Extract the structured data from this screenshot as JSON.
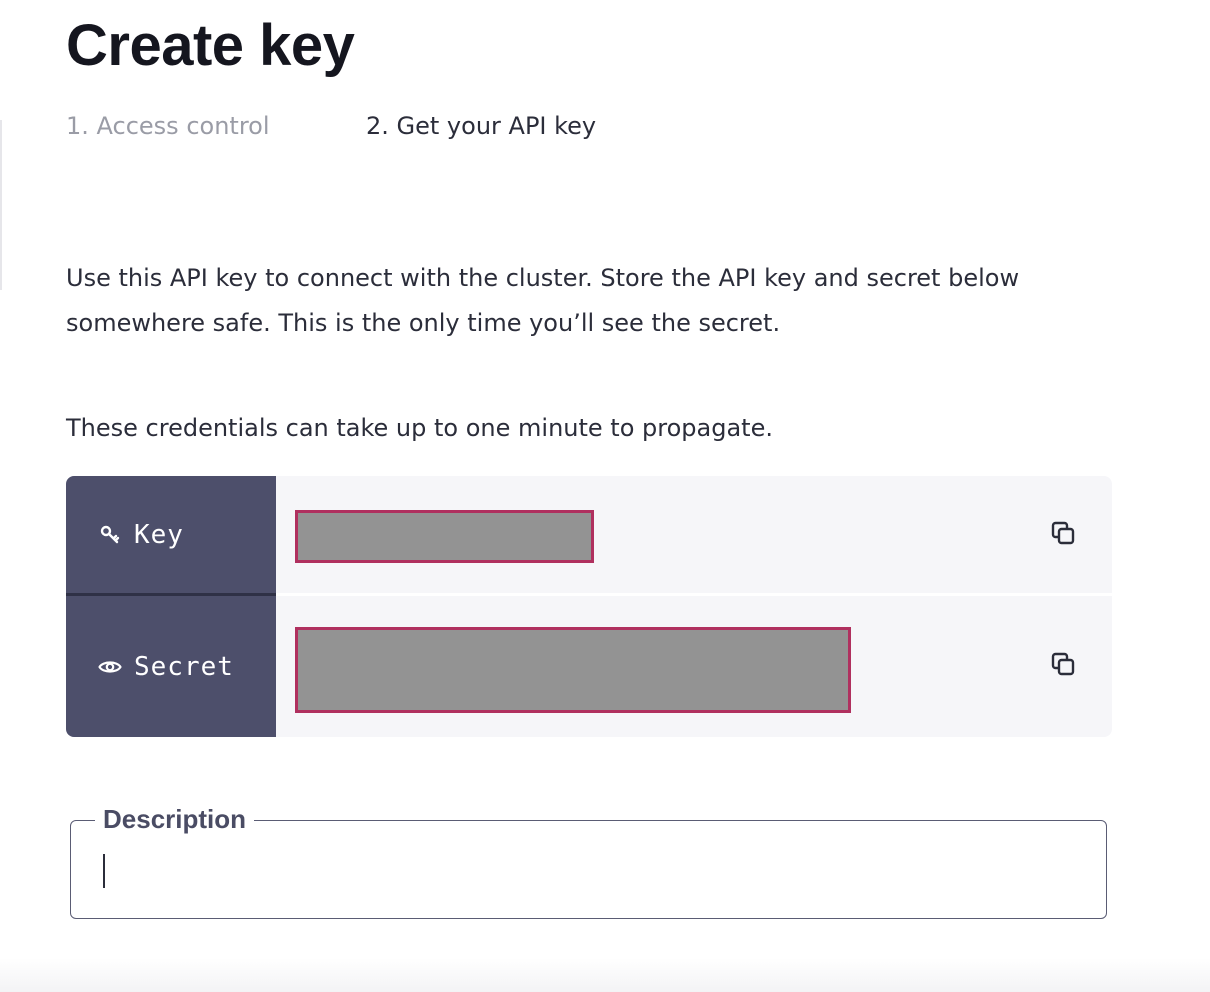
{
  "header": {
    "title": "Create key"
  },
  "steps": [
    {
      "label": "1. Access control",
      "state": "completed"
    },
    {
      "label": "2. Get your API key",
      "state": "active"
    }
  ],
  "body": {
    "intro_line_1": "Use this API key to connect with the cluster. Store the API key and secret below",
    "intro_line_2": "somewhere safe. This is the only time you’ll see the secret.",
    "propagate_note": "These credentials can take up to one minute to propagate."
  },
  "credentials": {
    "key": {
      "label": "Key",
      "icon": "key-icon",
      "value_state": "redacted"
    },
    "secret": {
      "label": "Secret",
      "icon": "eye-icon",
      "value_state": "redacted"
    },
    "copy_icon": "copy-icon"
  },
  "description": {
    "label": "Description",
    "value": ""
  },
  "colors": {
    "label_bg": "#4d4f6b",
    "panel_bg": "#f6f6f9",
    "redaction_fill": "#939393",
    "redaction_border": "#b0305f",
    "step_muted": "#9a9ca6",
    "text": "#2b2d3a"
  }
}
